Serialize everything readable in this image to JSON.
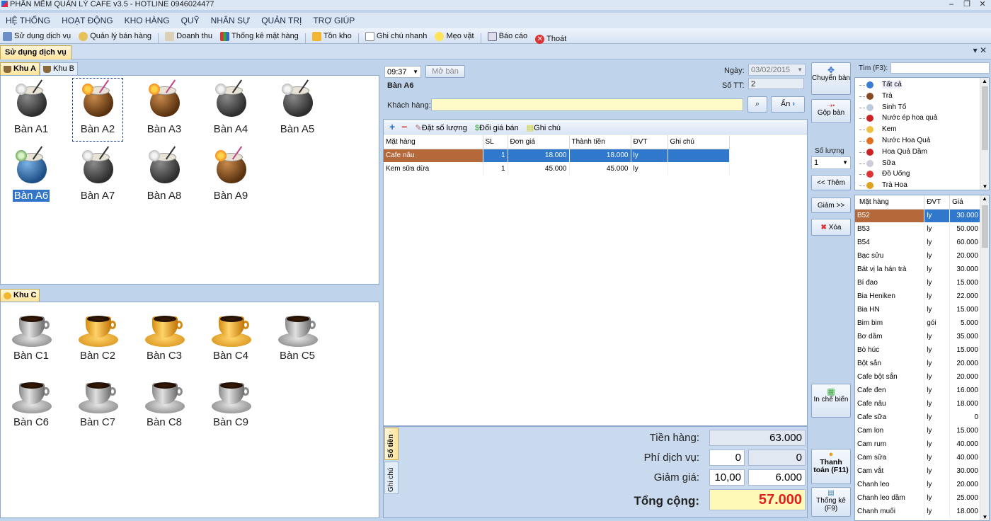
{
  "app": {
    "title": "PHẦN MỀM QUẢN LÝ CAFE v3.5 - HOTLINE 0946024477"
  },
  "menu": [
    "HỆ THỐNG",
    "HOẠT ĐỘNG",
    "KHO HÀNG",
    "QUỸ",
    "NHÂN SỰ",
    "QUẢN TRỊ",
    "TRỢ GIÚP"
  ],
  "toolbar": [
    {
      "label": "Sử dụng dịch vụ",
      "icon": "cart-icon"
    },
    {
      "label": "Quản lý bán hàng",
      "icon": "magnifier-icon"
    },
    {
      "label": "Doanh thu",
      "icon": "ledger-icon"
    },
    {
      "label": "Thống kê mặt hàng",
      "icon": "bar-chart-icon"
    },
    {
      "label": "Tồn kho",
      "icon": "warning-icon"
    },
    {
      "label": "Ghi chú nhanh",
      "icon": "note-icon"
    },
    {
      "label": "Mẹo vặt",
      "icon": "lightbulb-icon"
    },
    {
      "label": "Báo cáo",
      "icon": "report-icon"
    },
    {
      "label": "Thoát",
      "icon": "exit-icon"
    }
  ],
  "doc_tab": "Sử dụng dịch vụ",
  "zones_top": [
    "Khu A",
    "Khu B"
  ],
  "zone_c": "Khu C",
  "tables_a": [
    {
      "label": "Bàn A1",
      "style": "grey"
    },
    {
      "label": "Bàn A2",
      "style": "brown"
    },
    {
      "label": "Bàn A3",
      "style": "brown"
    },
    {
      "label": "Bàn A4",
      "style": "grey"
    },
    {
      "label": "Bàn A5",
      "style": "grey"
    },
    {
      "label": "Bàn A6",
      "style": "blue"
    },
    {
      "label": "Bàn A7",
      "style": "grey"
    },
    {
      "label": "Bàn A8",
      "style": "grey"
    },
    {
      "label": "Bàn A9",
      "style": "brown"
    }
  ],
  "tables_c": [
    {
      "label": "Bàn C1",
      "style": "grey"
    },
    {
      "label": "Bàn C2",
      "style": "orange"
    },
    {
      "label": "Bàn C3",
      "style": "orange"
    },
    {
      "label": "Bàn C4",
      "style": "orange"
    },
    {
      "label": "Bàn C5",
      "style": "grey"
    },
    {
      "label": "Bàn C6",
      "style": "grey"
    },
    {
      "label": "Bàn C7",
      "style": "grey"
    },
    {
      "label": "Bàn C8",
      "style": "grey"
    },
    {
      "label": "Bàn C9",
      "style": "grey"
    }
  ],
  "order": {
    "time": "09:37",
    "open_button": "Mở bàn",
    "table_name": "Bàn A6",
    "date_label": "Ngày:",
    "date_value": "03/02/2015",
    "stt_label": "Số TT:",
    "stt_value": "2",
    "customer_label": "Khách hàng:",
    "customer_value": "",
    "hide_button": "Ẩn",
    "tool_set_qty": "Đặt số lượng",
    "tool_change_price": "Đổi giá bán",
    "tool_note": "Ghi chú",
    "columns": [
      "Mặt hàng",
      "SL",
      "Đơn giá",
      "Thành tiền",
      "ĐVT",
      "Ghi chú"
    ],
    "rows": [
      [
        "Cafe nâu",
        "1",
        "18.000",
        "18.000",
        "ly",
        ""
      ],
      [
        "Kem sữa dừa",
        "1",
        "45.000",
        "45.000",
        "ly",
        ""
      ]
    ],
    "side_tabs": [
      "Số tiền",
      "Ghi chú"
    ],
    "summary": {
      "subtotal_label": "Tiền hàng:",
      "subtotal": "63.000",
      "service_label": "Phí dịch vụ:",
      "service_pct": "0",
      "service_amount": "0",
      "discount_label": "Giảm giá:",
      "discount_pct": "10,00",
      "discount_amount": "6.000",
      "total_label": "Tổng cộng:",
      "total": "57.000"
    }
  },
  "side_buttons": {
    "transfer": "Chuyển bàn",
    "merge": "Gộp bàn",
    "qty_label": "Số lượng",
    "qty_value": "1",
    "add": "<< Thêm",
    "reduce": "Giảm >>",
    "delete": "Xóa",
    "print": "In chế biến",
    "pay": "Thanh toán (F11)",
    "stats": "Thống kê (F9)"
  },
  "search": {
    "label": "Tìm (F3):",
    "value": ""
  },
  "categories": [
    {
      "label": "Tất cả",
      "icon": "globe-icon",
      "color": "#3a7bd5"
    },
    {
      "label": "Trà",
      "icon": "teapot-icon",
      "color": "#8a4a20"
    },
    {
      "label": "Sinh Tố",
      "icon": "glass-icon",
      "color": "#bcd"
    },
    {
      "label": "Nước ép hoa quả",
      "icon": "apple-icon",
      "color": "#c22"
    },
    {
      "label": "Kem",
      "icon": "icecream-icon",
      "color": "#f0c040"
    },
    {
      "label": "Nước Hoa Quả",
      "icon": "bottle-icon",
      "color": "#e07020"
    },
    {
      "label": "Hoa Quả Dầm",
      "icon": "fruit-icon",
      "color": "#c22"
    },
    {
      "label": "Sữa",
      "icon": "milk-icon",
      "color": "#ccd"
    },
    {
      "label": "Đồ Uống",
      "icon": "drink-icon",
      "color": "#d33"
    },
    {
      "label": "Trà Hoa",
      "icon": "flower-tea-icon",
      "color": "#e0a020"
    }
  ],
  "products": {
    "columns": [
      "Mặt hàng",
      "ĐVT",
      "Giá"
    ],
    "rows": [
      [
        "B52",
        "ly",
        "30.000"
      ],
      [
        "B53",
        "ly",
        "50.000"
      ],
      [
        "B54",
        "ly",
        "60.000"
      ],
      [
        "Bạc sửu",
        "ly",
        "20.000"
      ],
      [
        "Bát vị la hán trà",
        "ly",
        "30.000"
      ],
      [
        "Bí đao",
        "ly",
        "15.000"
      ],
      [
        "Bia Heniken",
        "ly",
        "22.000"
      ],
      [
        "Bia HN",
        "ly",
        "15.000"
      ],
      [
        "Bim bim",
        "gói",
        "5.000"
      ],
      [
        "Bơ dầm",
        "ly",
        "35.000"
      ],
      [
        "Bò húc",
        "ly",
        "15.000"
      ],
      [
        "Bột sắn",
        "ly",
        "20.000"
      ],
      [
        "Cafe bột sắn",
        "ly",
        "20.000"
      ],
      [
        "Cafe đen",
        "ly",
        "16.000"
      ],
      [
        "Cafe nâu",
        "ly",
        "18.000"
      ],
      [
        "Cafe sữa",
        "ly",
        "0"
      ],
      [
        "Cam lon",
        "ly",
        "15.000"
      ],
      [
        "Cam rum",
        "ly",
        "40.000"
      ],
      [
        "Cam sữa",
        "ly",
        "40.000"
      ],
      [
        "Cam vắt",
        "ly",
        "30.000"
      ],
      [
        "Chanh leo",
        "ly",
        "20.000"
      ],
      [
        "Chanh leo dầm",
        "ly",
        "25.000"
      ],
      [
        "Chanh muối",
        "ly",
        "18.000"
      ]
    ]
  }
}
